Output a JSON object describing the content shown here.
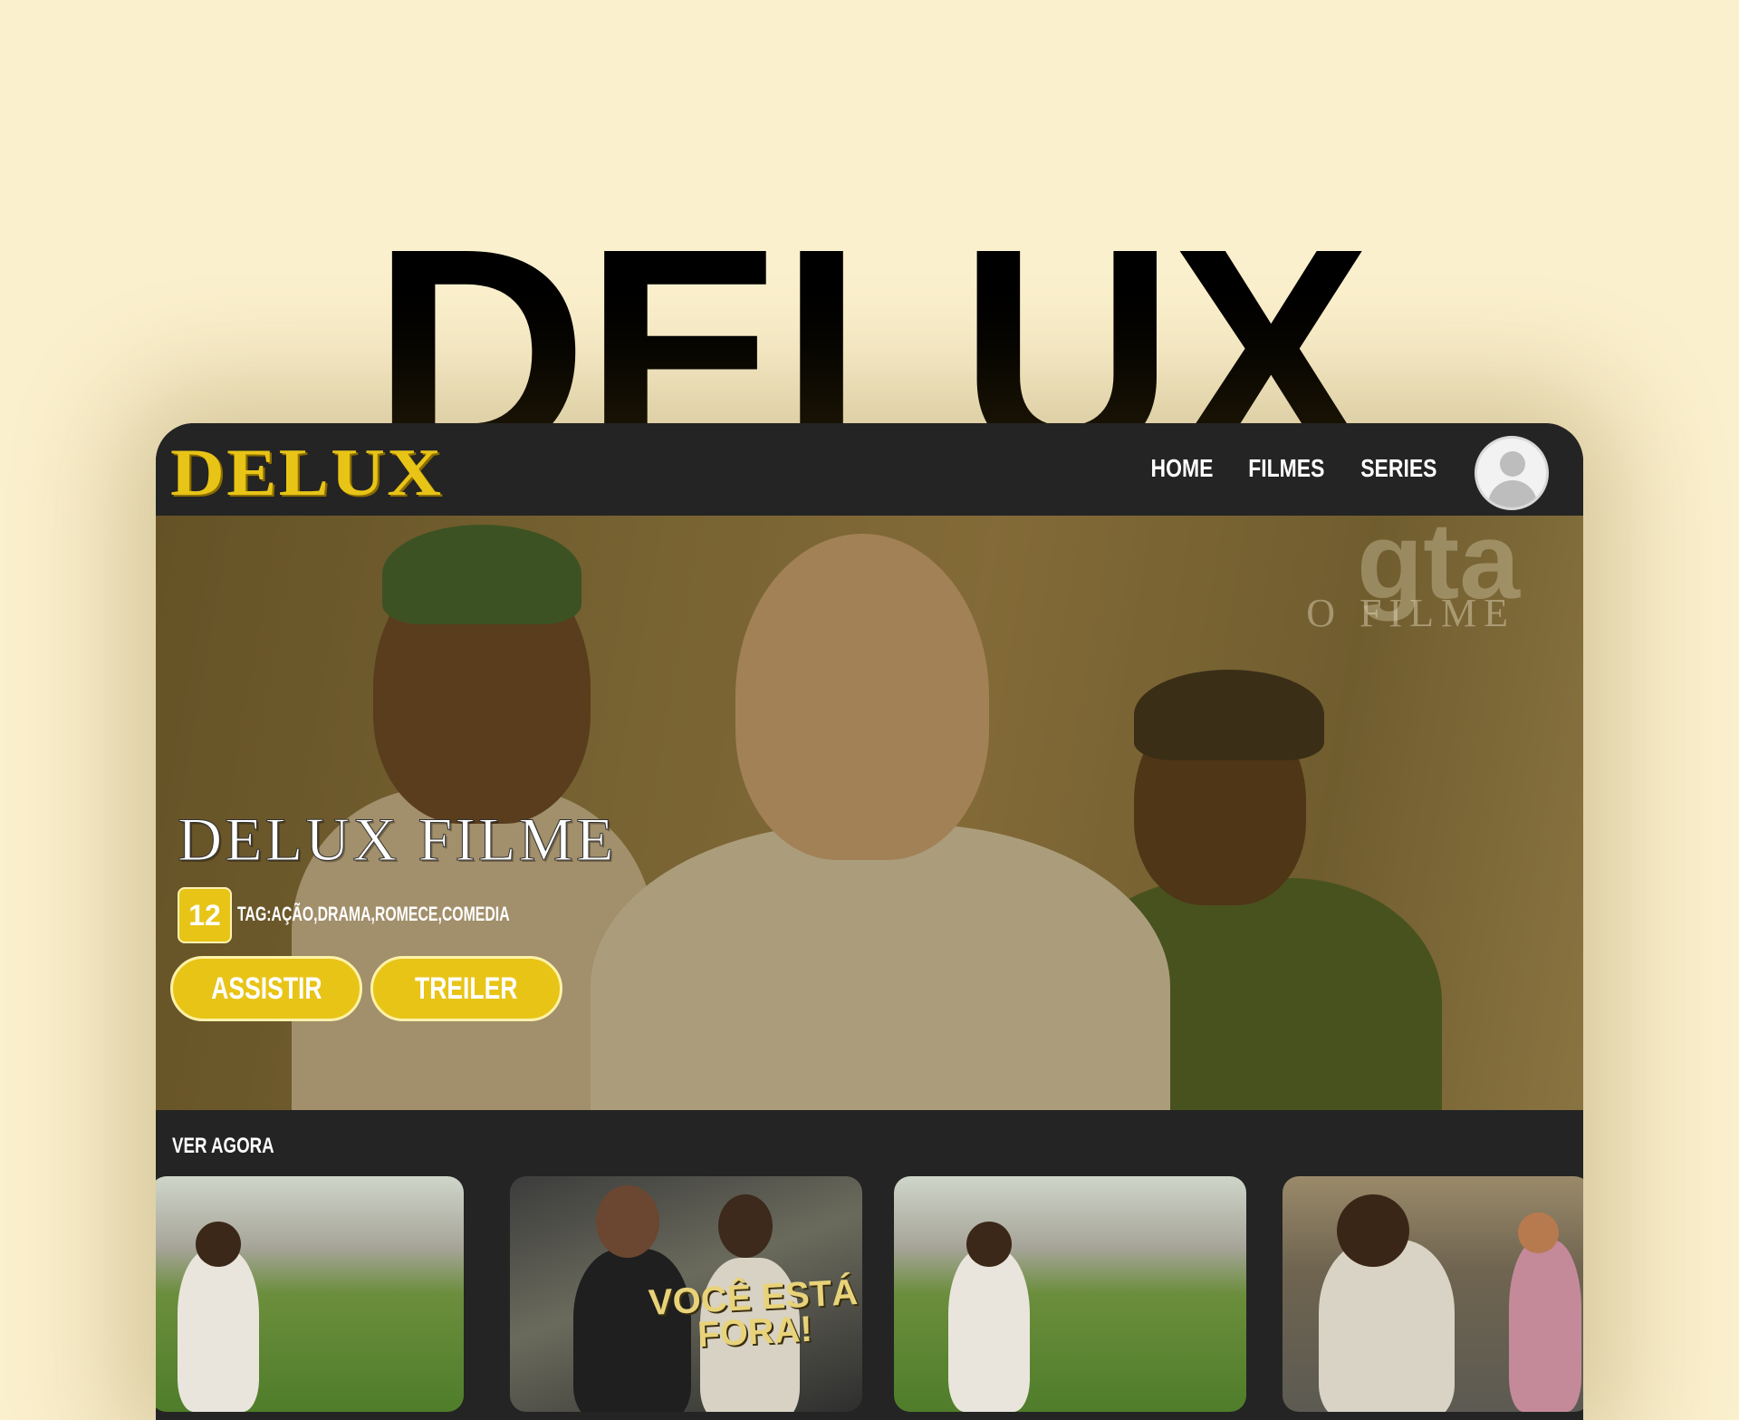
{
  "hero_heading": "DELUX",
  "app": {
    "logo": "DELUX",
    "nav": [
      "HOME",
      "FILMES",
      "SERIES"
    ],
    "avatar_icon": "user-avatar-icon"
  },
  "featured": {
    "poster_mark": "gta",
    "poster_sub": "O FILME",
    "title": "DELUX FILME",
    "rating": "12",
    "tags": "TAG:AÇÃO,DRAMA,ROMECE,COMEDIA",
    "watch_button": "ASSISTIR",
    "trailer_button": "TREILER"
  },
  "section": {
    "title": "VER AGORA",
    "thumbnails": [
      {
        "caption": ""
      },
      {
        "caption": "VOCÊ ESTÁ FORA!"
      },
      {
        "caption": ""
      },
      {
        "caption": ""
      }
    ]
  },
  "colors": {
    "background": "#fbf0cd",
    "accent": "#e8c417",
    "panel": "#242424"
  }
}
